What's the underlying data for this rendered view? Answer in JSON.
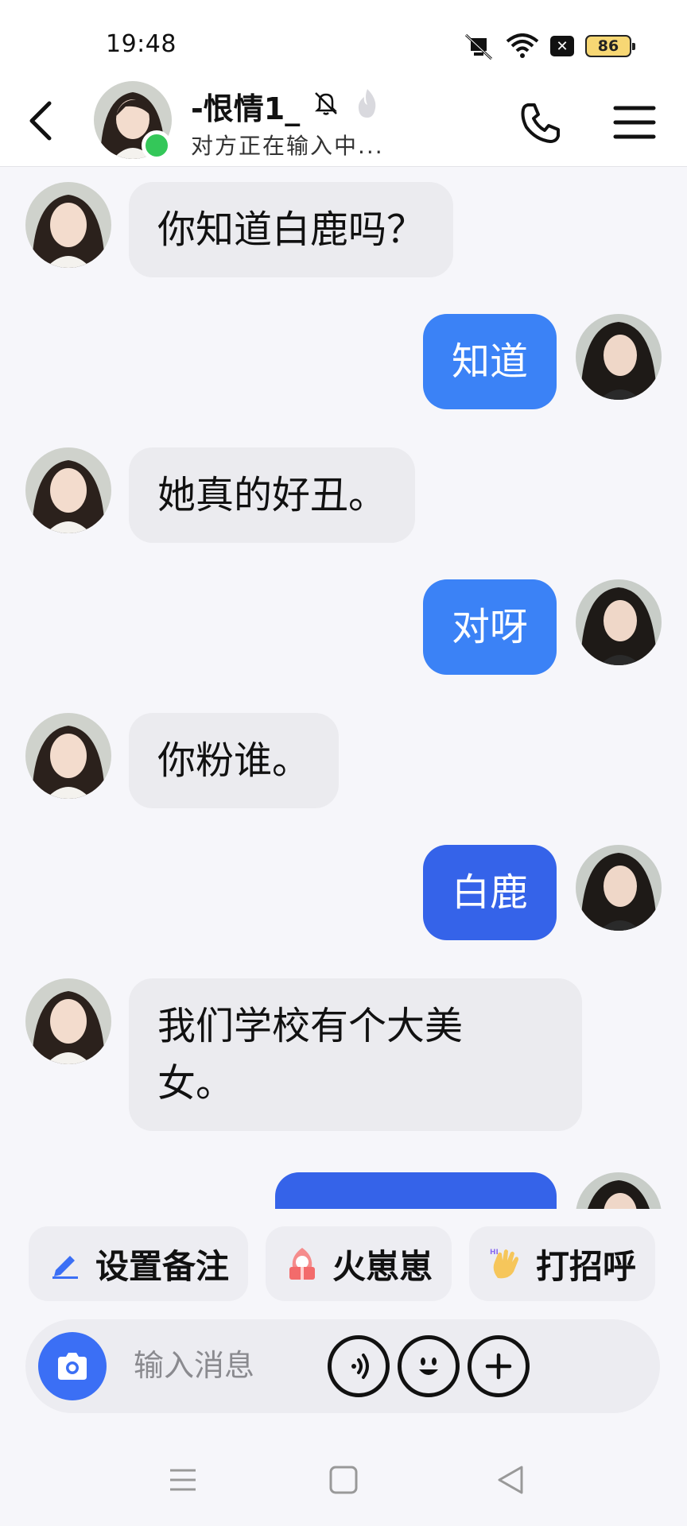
{
  "status_bar": {
    "time": "19:48",
    "battery": "86",
    "icons": [
      "mute-icon",
      "wifi-icon",
      "no-sim-icon",
      "battery-icon"
    ]
  },
  "header": {
    "contact_name": "-恨情1_",
    "status": "对方正在输入中...",
    "icons": [
      "back-icon",
      "bell-off-icon",
      "flame-icon",
      "phone-icon",
      "menu-icon"
    ]
  },
  "messages": [
    {
      "side": "in",
      "text": "你知道白鹿吗？"
    },
    {
      "side": "out",
      "text": "知道"
    },
    {
      "side": "in",
      "text": "她真的好丑。"
    },
    {
      "side": "out",
      "text": "对呀"
    },
    {
      "side": "in",
      "text": "你粉谁。"
    },
    {
      "side": "out",
      "text": "白鹿"
    },
    {
      "side": "in",
      "text": "我们学校有个大美\n女。"
    },
    {
      "side": "out",
      "text": ""
    }
  ],
  "quick_actions": [
    {
      "label": "设置备注",
      "icon": "pencil-icon"
    },
    {
      "label": "火崽崽",
      "icon": "mascot-icon"
    },
    {
      "label": "打招呼",
      "icon": "wave-hand-icon"
    }
  ],
  "input": {
    "placeholder": "输入消息"
  },
  "colors": {
    "accent": "#3b82f6",
    "incoming_bubble": "#ebebef",
    "online": "#34c759",
    "camera": "#3b6ff5"
  }
}
